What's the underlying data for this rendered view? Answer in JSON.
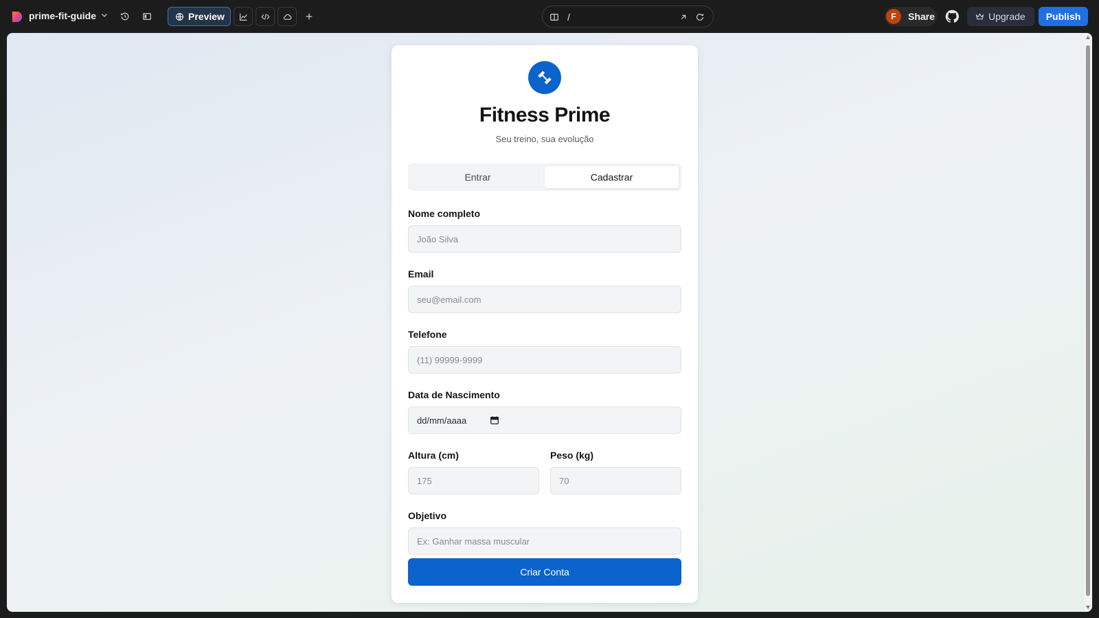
{
  "app": {
    "project_name": "prime-fit-guide",
    "preview_label": "Preview",
    "url_path": "/",
    "share_label": "Share",
    "avatar_initial": "F",
    "upgrade_label": "Upgrade",
    "publish_label": "Publish",
    "colors": {
      "accent": "#1f6fe5",
      "avatar": "#c2410c"
    }
  },
  "card": {
    "title": "Fitness Prime",
    "subtitle": "Seu treino, sua evolução",
    "tabs": [
      {
        "label": "Entrar",
        "active": false
      },
      {
        "label": "Cadastrar",
        "active": true
      }
    ],
    "fields": {
      "name": {
        "label": "Nome completo",
        "placeholder": "João Silva"
      },
      "email": {
        "label": "Email",
        "placeholder": "seu@email.com"
      },
      "phone": {
        "label": "Telefone",
        "placeholder": "(11) 99999-9999"
      },
      "birth": {
        "label": "Data de Nascimento",
        "value": "dd/mm/aaaa"
      },
      "height": {
        "label": "Altura (cm)",
        "placeholder": "175"
      },
      "weight": {
        "label": "Peso (kg)",
        "placeholder": "70"
      },
      "goal": {
        "label": "Objetivo",
        "placeholder": "Ex: Ganhar massa muscular"
      }
    },
    "submit_label": "Criar Conta",
    "colors": {
      "primary": "#0b63cc"
    }
  }
}
